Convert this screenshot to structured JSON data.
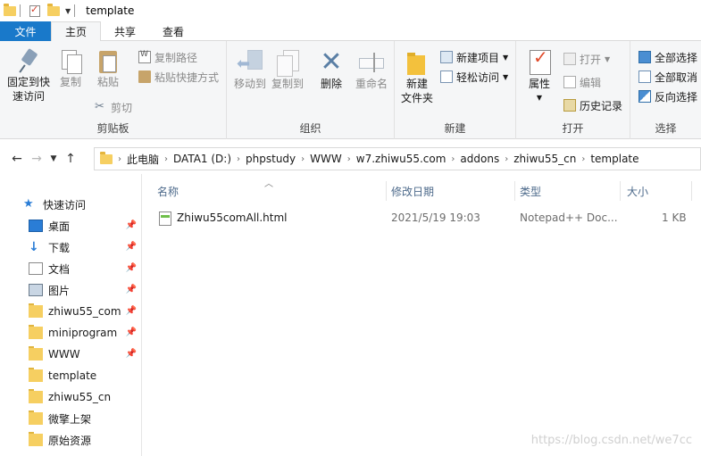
{
  "window": {
    "title": "template"
  },
  "tabs": {
    "file": "文件",
    "home": "主页",
    "share": "共享",
    "view": "查看"
  },
  "ribbon": {
    "clipboard": {
      "label": "剪贴板",
      "pin_line1": "固定到快",
      "pin_line2": "速访问",
      "copy": "复制",
      "paste": "粘贴",
      "copy_path": "复制路径",
      "paste_shortcut": "粘贴快捷方式",
      "cut": "剪切"
    },
    "organize": {
      "label": "组织",
      "move_to": "移动到",
      "copy_to": "复制到",
      "delete": "删除",
      "rename": "重命名"
    },
    "new": {
      "label": "新建",
      "new_folder_line1": "新建",
      "new_folder_line2": "文件夹",
      "new_item": "新建项目",
      "easy_access": "轻松访问"
    },
    "open": {
      "label": "打开",
      "properties": "属性",
      "open": "打开",
      "edit": "编辑",
      "history": "历史记录"
    },
    "select": {
      "label": "选择",
      "select_all": "全部选择",
      "select_none": "全部取消",
      "invert": "反向选择"
    }
  },
  "address": {
    "crumbs": [
      "此电脑",
      "DATA1 (D:)",
      "phpstudy",
      "WWW",
      "w7.zhiwu55.com",
      "addons",
      "zhiwu55_cn",
      "template"
    ]
  },
  "sidebar": {
    "quick_access": "快速访问",
    "items": [
      {
        "label": "桌面",
        "icon": "desktop-icon",
        "pinned": true
      },
      {
        "label": "下载",
        "icon": "download-icon",
        "pinned": true
      },
      {
        "label": "文档",
        "icon": "document-icon",
        "pinned": true
      },
      {
        "label": "图片",
        "icon": "picture-icon",
        "pinned": true
      },
      {
        "label": "zhiwu55_com",
        "icon": "folder-icon",
        "pinned": true
      },
      {
        "label": "miniprogram",
        "icon": "folder-icon",
        "pinned": true
      },
      {
        "label": "WWW",
        "icon": "folder-icon",
        "pinned": true
      },
      {
        "label": "template",
        "icon": "folder-icon",
        "pinned": false
      },
      {
        "label": "zhiwu55_cn",
        "icon": "folder-icon",
        "pinned": false
      },
      {
        "label": "微擎上架",
        "icon": "folder-icon",
        "pinned": false
      },
      {
        "label": "原始资源",
        "icon": "folder-icon",
        "pinned": false
      }
    ]
  },
  "filelist": {
    "columns": {
      "name": "名称",
      "modified": "修改日期",
      "type": "类型",
      "size": "大小"
    },
    "rows": [
      {
        "name": "Zhiwu55comAll.html",
        "modified": "2021/5/19 19:03",
        "type": "Notepad++ Doc...",
        "size": "1 KB"
      }
    ]
  },
  "watermark": "https://blog.csdn.net/we7cc",
  "colors": {
    "accent": "#1979ca",
    "ribbon_bg": "#f5f6f7",
    "folder": "#f6cf61",
    "header_text": "#4d6a8b"
  }
}
